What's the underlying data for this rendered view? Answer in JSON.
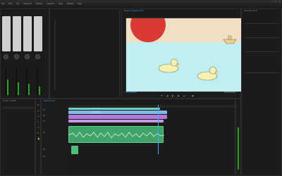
{
  "app": {
    "title": "",
    "window_controls": [
      "–",
      "□",
      "✕"
    ]
  },
  "menu": [
    "File",
    "Edit",
    "Clip",
    "Sequence",
    "Markers",
    "Graphics",
    "View",
    "Window",
    "Help"
  ],
  "panels": {
    "audio_mixer": {
      "tabs": [
        "",
        "",
        "",
        "",
        ""
      ],
      "channel_count": 4
    },
    "program_monitor": {
      "tab": "Program: Sequence 01",
      "timecode_left": "00:00:00:00",
      "timecode_right": "00:00:00:00",
      "scene": {
        "description_icons": [
          "apple",
          "duck",
          "duck",
          "boat"
        ]
      }
    },
    "effect_controls": {
      "tab": "Essential Sound"
    },
    "project": {
      "tab": "Project: Untitled"
    },
    "timeline": {
      "tab": "Sequence 01",
      "tracks": [
        "V3",
        "V2",
        "V1",
        "A1",
        "A2",
        "A3"
      ]
    }
  },
  "colors": {
    "accent": "#4aa3ff",
    "meter_green": "#25a325",
    "clip_purple": "#b07ad8",
    "clip_green": "#4fbf7a",
    "clip_teal": "#6fd6c6",
    "clip_blue": "#7fb7e6",
    "water": "#bfeff0",
    "sky": "#f0dfc0",
    "apple_red": "#d93a34"
  }
}
